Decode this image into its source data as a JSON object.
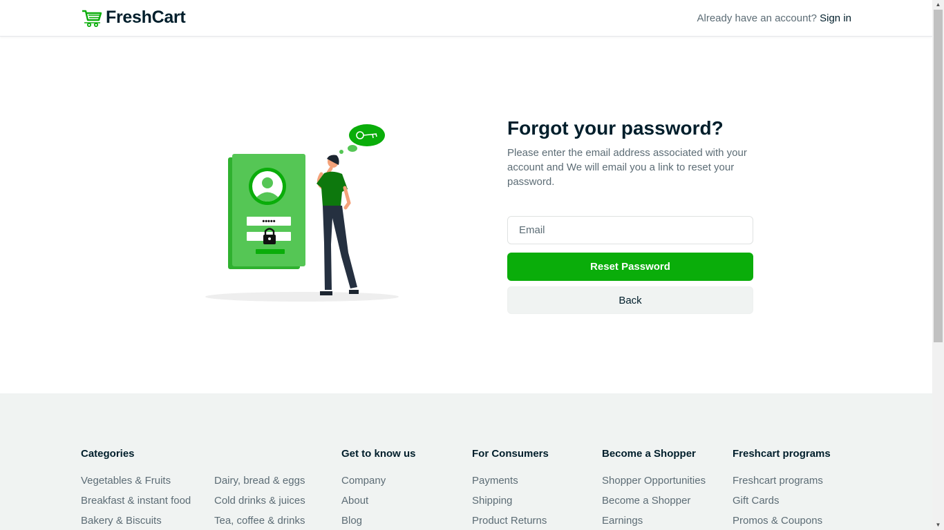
{
  "header": {
    "logo_text": "FreshCart",
    "account_prompt": "Already have an account?",
    "signin_label": "Sign in"
  },
  "form": {
    "title": "Forgot your password?",
    "description": "Please enter the email address associated with your account and We will email you a link to reset your password.",
    "email_placeholder": "Email",
    "reset_label": "Reset Password",
    "back_label": "Back"
  },
  "footer": {
    "categories": {
      "heading": "Categories",
      "col1": [
        "Vegetables & Fruits",
        "Breakfast & instant food",
        "Bakery & Biscuits"
      ],
      "col2": [
        "Dairy, bread & eggs",
        "Cold drinks & juices",
        "Tea, coffee & drinks"
      ]
    },
    "get_to_know": {
      "heading": "Get to know us",
      "links": [
        "Company",
        "About",
        "Blog"
      ]
    },
    "for_consumers": {
      "heading": "For Consumers",
      "links": [
        "Payments",
        "Shipping",
        "Product Returns"
      ]
    },
    "become_shopper": {
      "heading": "Become a Shopper",
      "links": [
        "Shopper Opportunities",
        "Become a Shopper",
        "Earnings"
      ]
    },
    "programs": {
      "heading": "Freshcart programs",
      "links": [
        "Freshcart programs",
        "Gift Cards",
        "Promos & Coupons"
      ]
    }
  },
  "illustration": {
    "password_dots": "•••••"
  },
  "colors": {
    "brand_green": "#0aad0a",
    "text_dark": "#001e2b",
    "text_muted": "#5c6c75",
    "footer_bg": "#f0f3f2"
  },
  "icons": [
    "cart-logo-icon",
    "key-icon",
    "lock-icon",
    "user-avatar-icon"
  ]
}
